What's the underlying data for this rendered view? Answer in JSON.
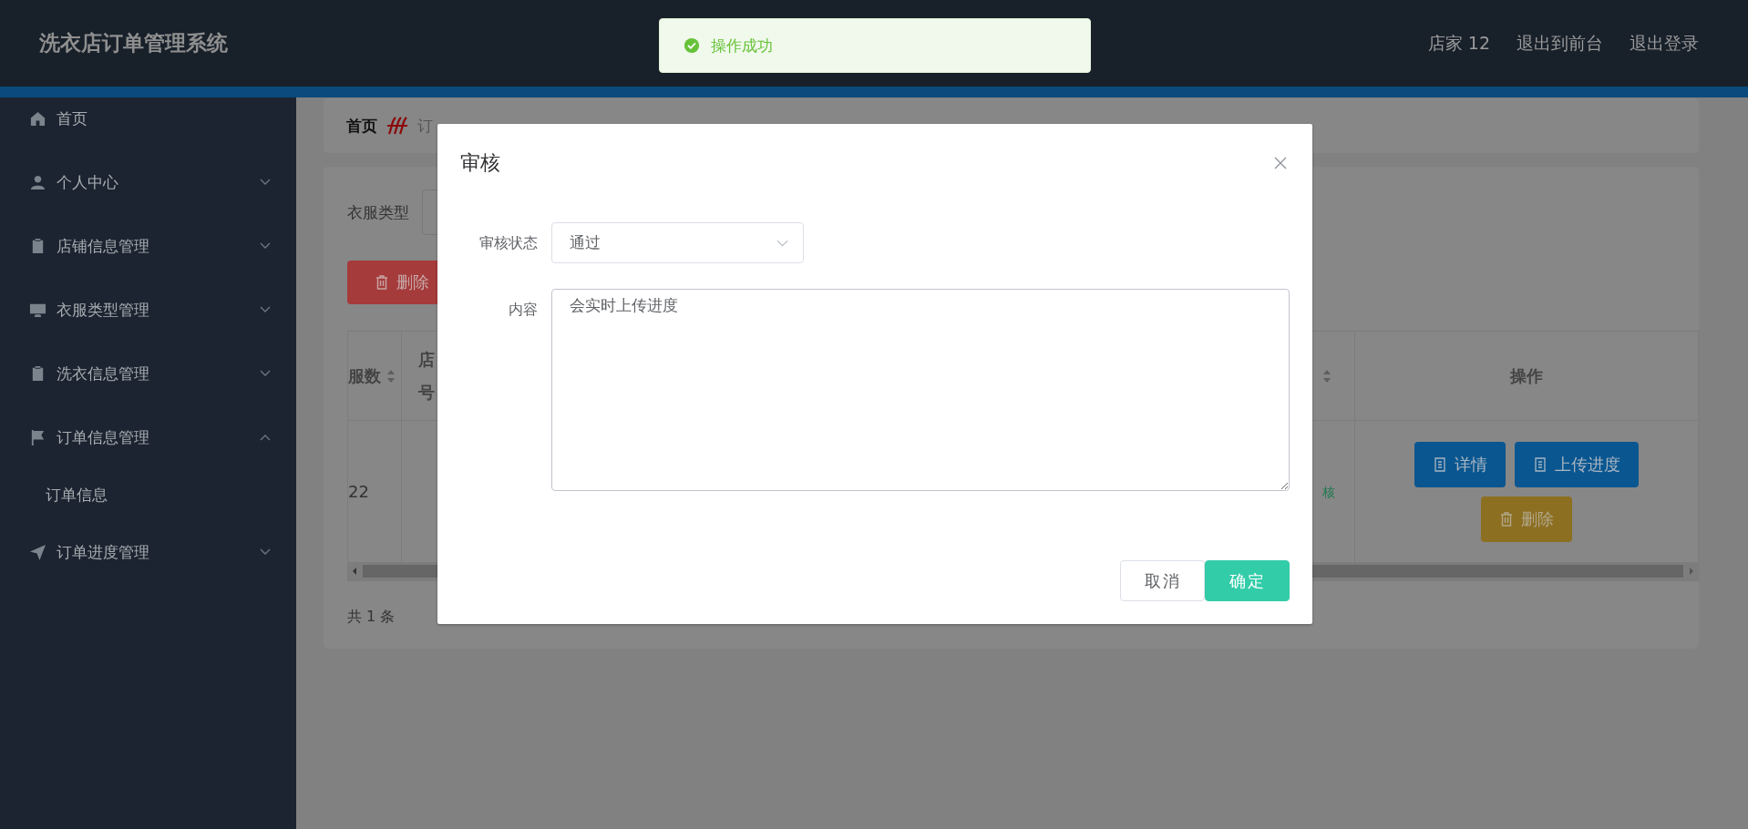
{
  "header": {
    "title": "洗衣店订单管理系统",
    "links": [
      "店家 12",
      "退出到前台",
      "退出登录"
    ]
  },
  "toast": {
    "message": "操作成功"
  },
  "sidebar": {
    "items": [
      {
        "kind": "link",
        "label": "首页"
      },
      {
        "kind": "submenu",
        "label": "个人中心",
        "expanded": false
      },
      {
        "kind": "submenu",
        "label": "店铺信息管理",
        "expanded": false
      },
      {
        "kind": "submenu",
        "label": "衣服类型管理",
        "expanded": false
      },
      {
        "kind": "submenu",
        "label": "洗衣信息管理",
        "expanded": false
      },
      {
        "kind": "submenu",
        "label": "订单信息管理",
        "expanded": true,
        "children": [
          {
            "label": "订单信息"
          }
        ]
      },
      {
        "kind": "submenu",
        "label": "订单进度管理",
        "expanded": false
      }
    ]
  },
  "breadcrumb": [
    "首页",
    "订"
  ],
  "filter": {
    "label": "衣服类型"
  },
  "toolbar": {
    "delete_button": "删除"
  },
  "table": {
    "columns": [
      {
        "label": "服数",
        "sortable": true
      },
      {
        "label": "店号",
        "sortable": false
      },
      {
        "sortable": true
      },
      {
        "label": "操作",
        "sortable": false
      }
    ],
    "rows": [
      {
        "quantity": "22",
        "status": "核",
        "actions": [
          {
            "label": "详情",
            "kind": "primary"
          },
          {
            "label": "上传进度",
            "kind": "primary"
          },
          {
            "label": "删除",
            "kind": "warning"
          }
        ]
      }
    ]
  },
  "pagination": {
    "total": "共 1 条"
  },
  "dialog": {
    "title": "审核",
    "fields": [
      {
        "kind": "select",
        "label": "审核状态",
        "value": "通过"
      },
      {
        "kind": "textarea",
        "label": "内容",
        "value": "会实时上传进度"
      }
    ],
    "buttons": [
      {
        "label": "取消",
        "kind": "default"
      },
      {
        "label": "确定",
        "kind": "primary"
      }
    ]
  }
}
